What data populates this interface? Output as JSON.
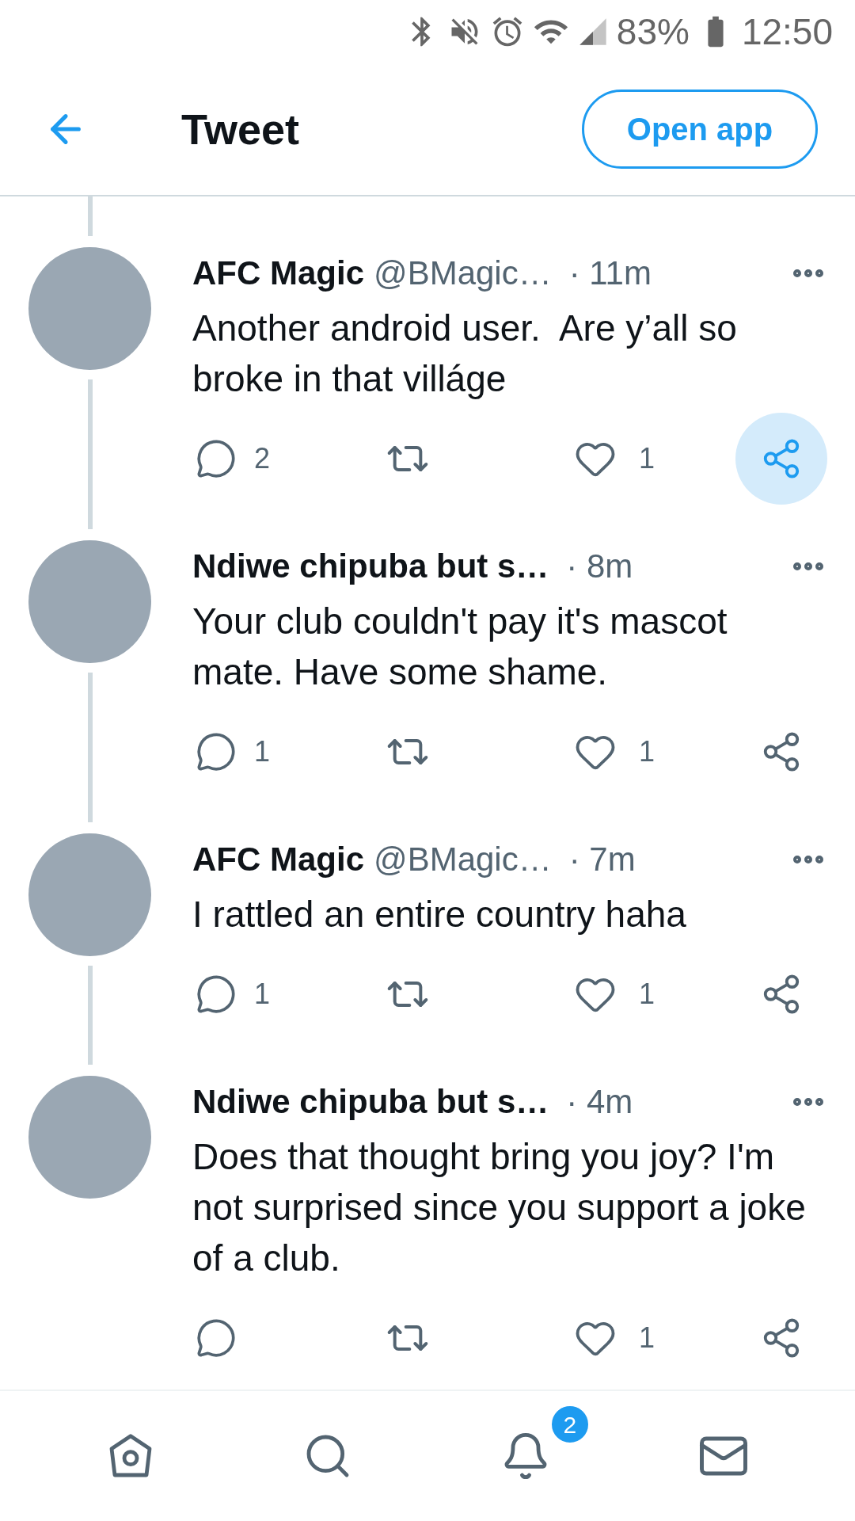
{
  "status_bar": {
    "battery": "83%",
    "time": "12:50"
  },
  "header": {
    "title": "Tweet",
    "open_app": "Open app"
  },
  "thread": {
    "continues_above": true
  },
  "tweets": [
    {
      "name": "AFC Magic",
      "handle": "@BMagic…",
      "time": "· 11m",
      "text": "Another android user.  Are y’all so broke in that villáge",
      "replies": "2",
      "likes": "1",
      "thread_below": true,
      "share_pressed": true
    },
    {
      "name": "Ndiwe chipuba but s…",
      "time": "· 8m",
      "text": "Your club couldn't pay it's mascot mate. Have some shame.",
      "replies": "1",
      "likes": "1",
      "thread_below": true,
      "share_pressed": false
    },
    {
      "name": "AFC Magic",
      "handle": "@BMagic…",
      "time": "· 7m",
      "text": "I rattled an entire country haha",
      "replies": "1",
      "likes": "1",
      "thread_below": true,
      "share_pressed": false
    },
    {
      "name": "Ndiwe chipuba but s…",
      "time": "· 4m",
      "text": "Does that thought bring you joy? I'm not surprised since you support a joke of a club.",
      "likes": "1",
      "thread_below": false,
      "share_pressed": false
    }
  ],
  "bottom_nav": {
    "notifications_badge": "2"
  }
}
